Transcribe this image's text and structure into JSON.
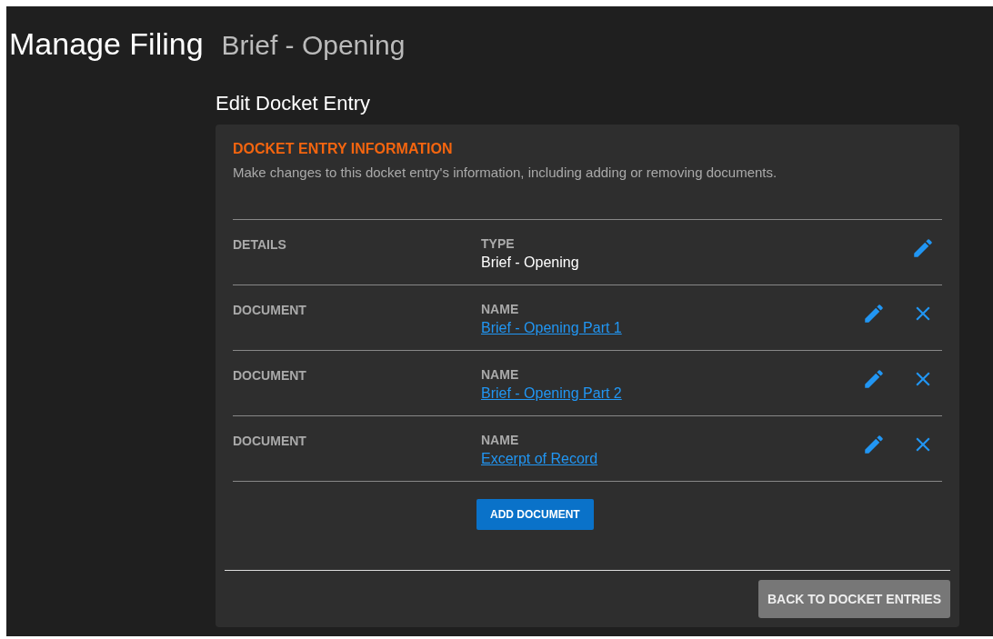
{
  "page": {
    "title": "Manage Filing",
    "subtitle": "Brief - Opening"
  },
  "section_title": "Edit Docket Entry",
  "card": {
    "heading": "DOCKET ENTRY INFORMATION",
    "description": "Make changes to this docket entry's information, including adding or removing documents.",
    "rows": [
      {
        "kind": "details",
        "label": "DETAILS",
        "field_label": "TYPE",
        "value": "Brief - Opening"
      },
      {
        "kind": "document",
        "label": "DOCUMENT",
        "field_label": "NAME",
        "value": "Brief - Opening Part 1"
      },
      {
        "kind": "document",
        "label": "DOCUMENT",
        "field_label": "NAME",
        "value": "Brief - Opening Part 2"
      },
      {
        "kind": "document",
        "label": "DOCUMENT",
        "field_label": "NAME",
        "value": "Excerpt of Record"
      }
    ],
    "add_button": "ADD DOCUMENT",
    "back_button": "BACK TO DOCKET ENTRIES"
  }
}
